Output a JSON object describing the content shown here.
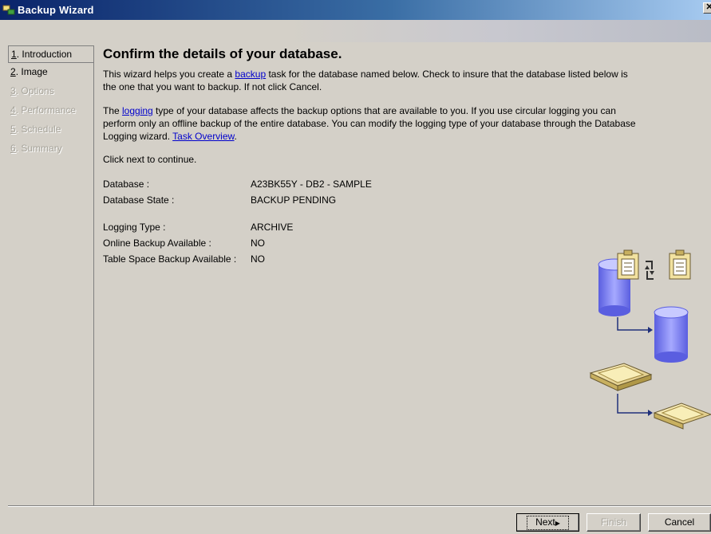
{
  "window": {
    "title": "Backup Wizard",
    "close_glyph": "✕"
  },
  "steps": [
    {
      "num": "1",
      "label": ". Introduction",
      "state": "active"
    },
    {
      "num": "2",
      "label": ". Image",
      "state": "enabled"
    },
    {
      "num": "3",
      "label": ". Options",
      "state": "disabled"
    },
    {
      "num": "4",
      "label": ". Performance",
      "state": "disabled"
    },
    {
      "num": "5",
      "label": ". Schedule",
      "state": "disabled"
    },
    {
      "num": "6",
      "label": ". Summary",
      "state": "disabled"
    }
  ],
  "content": {
    "heading": "Confirm the details of your database.",
    "para1": {
      "before": "This wizard helps you create a ",
      "link": "backup",
      "after": " task for the database named below.  Check to insure that the database listed below is",
      "line2": "the one that you want to backup.  If not click Cancel."
    },
    "para2": {
      "before": "The ",
      "link": "logging",
      "after": " type of your database affects the backup options that are available to you.  If you use circular logging you can",
      "line2": "perform only an offline backup of the entire database.  You can modify the logging type of your database through the Database",
      "line3": "Logging wizard.  ",
      "link2": "Task Overview",
      "end": "."
    },
    "continue_text": "Click next to continue.",
    "details": [
      {
        "label": "Database :",
        "value": "A23BK55Y - DB2 - SAMPLE"
      },
      {
        "label": "Database State :",
        "value": "BACKUP PENDING"
      }
    ],
    "details2": [
      {
        "label": "Logging Type :",
        "value": "ARCHIVE"
      },
      {
        "label": "Online Backup Available :",
        "value": "NO"
      },
      {
        "label": "Table Space Backup Available :",
        "value": "NO"
      }
    ]
  },
  "buttons": {
    "next": "Next",
    "next_arrow": "▶",
    "finish": "Finish",
    "cancel": "Cancel"
  },
  "colors": {
    "titlebar_start": "#0a246a",
    "titlebar_end": "#a6caf0",
    "dialog_bg": "#d4d0c8",
    "link": "#0000cc",
    "cylinder": "#7b7ff0",
    "clipboard": "#f2e2a0"
  }
}
